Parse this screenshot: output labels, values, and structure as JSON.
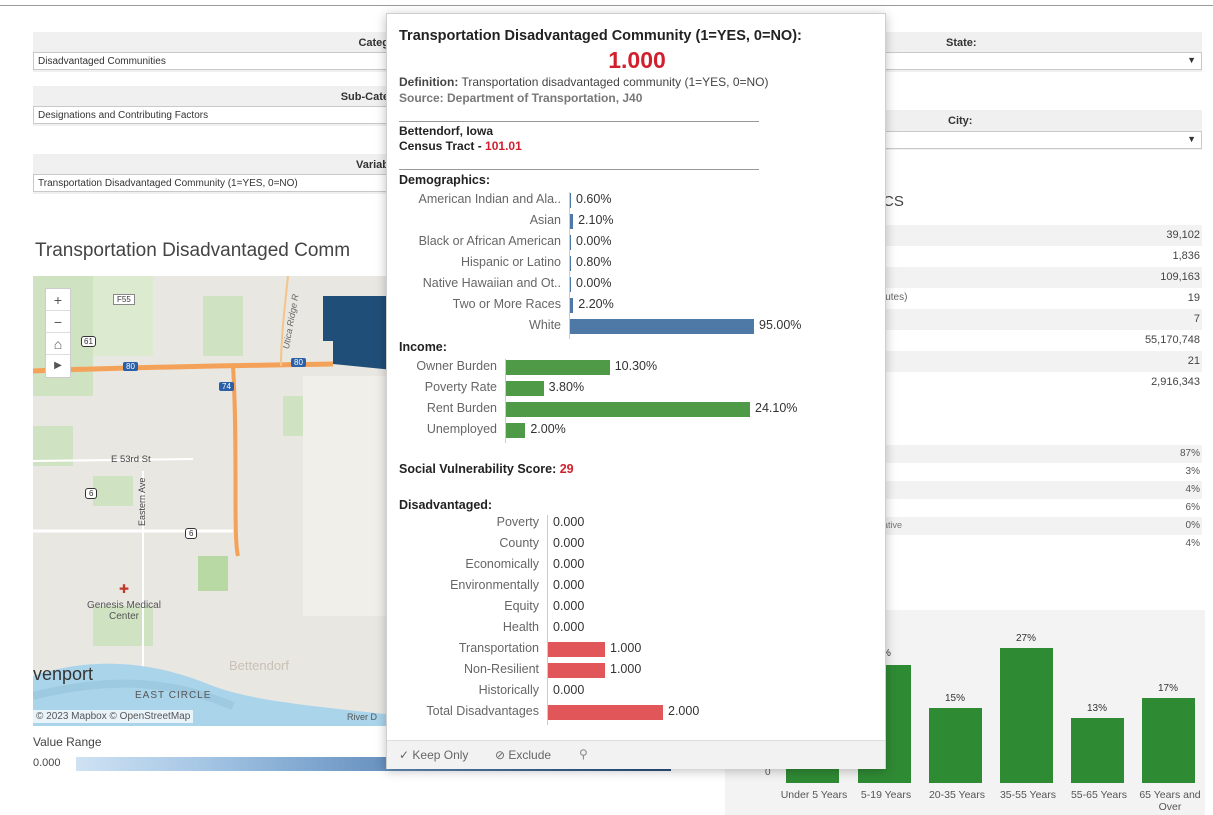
{
  "filters": {
    "category": {
      "label": "Categ",
      "value": "Disadvantaged Communities"
    },
    "subcategory": {
      "label": "Sub-Cate",
      "value": "Designations and Contributing Factors"
    },
    "variable": {
      "label": "Variab",
      "value": "Transportation Disadvantaged Community (1=YES, 0=NO)"
    },
    "state": {
      "label": "State:"
    },
    "city": {
      "label": "City:"
    }
  },
  "map_section": {
    "title": "Transportation Disadvantaged Comm",
    "attribution": "© 2023 Mapbox © OpenStreetMap",
    "attribution_tail": "River D",
    "labels": {
      "street_e53": "E 53rd St",
      "eastern_ave": "Eastern Ave",
      "utica_ridge": "Utica Ridge R",
      "genesis": "Genesis Medical",
      "genesis2": "Center",
      "davenport": "venport",
      "bettendorf": "Bettendorf",
      "east_circle": "EAST CIRCLE",
      "f55": "F55",
      "i80": "80",
      "i74": "74",
      "us61": "61",
      "us6": "6"
    },
    "value_range_label": "Value Range",
    "value_range_min": "0.000"
  },
  "tooltip": {
    "title": "Transportation Disadvantaged Community (1=YES, 0=NO):",
    "value": "1.000",
    "definition_label": "Definition:",
    "definition_text": "Transportation disadvantaged community (1=YES, 0=NO)",
    "source": "Source: Department of Transportation, J40",
    "place": "Bettendorf, Iowa",
    "tract_label": "Census Tract -",
    "tract_value": "101.01",
    "demographics": {
      "header": "Demographics:",
      "rows": [
        {
          "label": "American Indian and Ala..",
          "text": "0.60%",
          "value": 0.6
        },
        {
          "label": "Asian",
          "text": "2.10%",
          "value": 2.1
        },
        {
          "label": "Black or African American",
          "text": "0.00%",
          "value": 0.0
        },
        {
          "label": "Hispanic or Latino",
          "text": "0.80%",
          "value": 0.8
        },
        {
          "label": "Native Hawaiian and Ot..",
          "text": "0.00%",
          "value": 0.0
        },
        {
          "label": "Two or More Races",
          "text": "2.20%",
          "value": 2.2
        },
        {
          "label": "White",
          "text": "95.00%",
          "value": 95.0
        }
      ]
    },
    "income": {
      "header": "Income:",
      "rows": [
        {
          "label": "Owner Burden",
          "text": "10.30%",
          "value": 10.3
        },
        {
          "label": "Poverty Rate",
          "text": "3.80%",
          "value": 3.8
        },
        {
          "label": "Rent Burden",
          "text": "24.10%",
          "value": 24.1
        },
        {
          "label": "Unemployed",
          "text": "2.00%",
          "value": 2.0
        }
      ]
    },
    "svs_label": "Social Vulnerability Score:",
    "svs_value": "29",
    "disadvantaged": {
      "header": "Disadvantaged:",
      "rows": [
        {
          "label": "Poverty",
          "text": "0.000",
          "value": 0
        },
        {
          "label": "County",
          "text": "0.000",
          "value": 0
        },
        {
          "label": "Economically",
          "text": "0.000",
          "value": 0
        },
        {
          "label": "Environmentally",
          "text": "0.000",
          "value": 0
        },
        {
          "label": "Equity",
          "text": "0.000",
          "value": 0
        },
        {
          "label": "Health",
          "text": "0.000",
          "value": 0
        },
        {
          "label": "Transportation",
          "text": "1.000",
          "value": 1
        },
        {
          "label": "Non-Resilient",
          "text": "1.000",
          "value": 1
        },
        {
          "label": "Historically",
          "text": "0.000",
          "value": 0
        },
        {
          "label": "Total Disadvantages",
          "text": "2.000",
          "value": 2
        }
      ]
    },
    "actions": {
      "keep_only": "Keep Only",
      "exclude": "Exclude"
    },
    "colors": {
      "demographic_bar": "#4e79a7",
      "income_bar": "#4e9a46",
      "disadvantaged_bar": "#e15759",
      "accent_red": "#d11f2e"
    }
  },
  "right_panel": {
    "section_heading_fragment": "CS",
    "stats": [
      {
        "label": "",
        "value": "39,102"
      },
      {
        "label": "",
        "value": "1,836"
      },
      {
        "label": "",
        "value": "109,163"
      },
      {
        "label": "iutes)",
        "value": "19"
      },
      {
        "label": "",
        "value": "7"
      },
      {
        "label": "",
        "value": "55,170,748"
      },
      {
        "label": "",
        "value": "21"
      },
      {
        "label": "",
        "value": "2,916,343"
      }
    ],
    "percents": [
      {
        "label": "",
        "value": "87%"
      },
      {
        "label": "",
        "value": "3%"
      },
      {
        "label": "",
        "value": "4%"
      },
      {
        "label": "",
        "value": "6%"
      },
      {
        "label": "ative",
        "value": "0%"
      },
      {
        "label": "",
        "value": "4%"
      }
    ],
    "age_chart_fragment": "%"
  },
  "chart_data": {
    "type": "bar",
    "title": "",
    "categories": [
      "Under 5 Years",
      "5-19 Years",
      "20-35 Years",
      "35-55 Years",
      "55-65 Years",
      "65 Years and Over"
    ],
    "values": [
      null,
      null,
      15,
      27,
      13,
      17
    ],
    "labels": [
      "",
      "",
      "15%",
      "27%",
      "13%",
      "17%"
    ],
    "ylim": [
      0,
      30
    ],
    "y_tick": "0",
    "color": "#2f8a34"
  }
}
